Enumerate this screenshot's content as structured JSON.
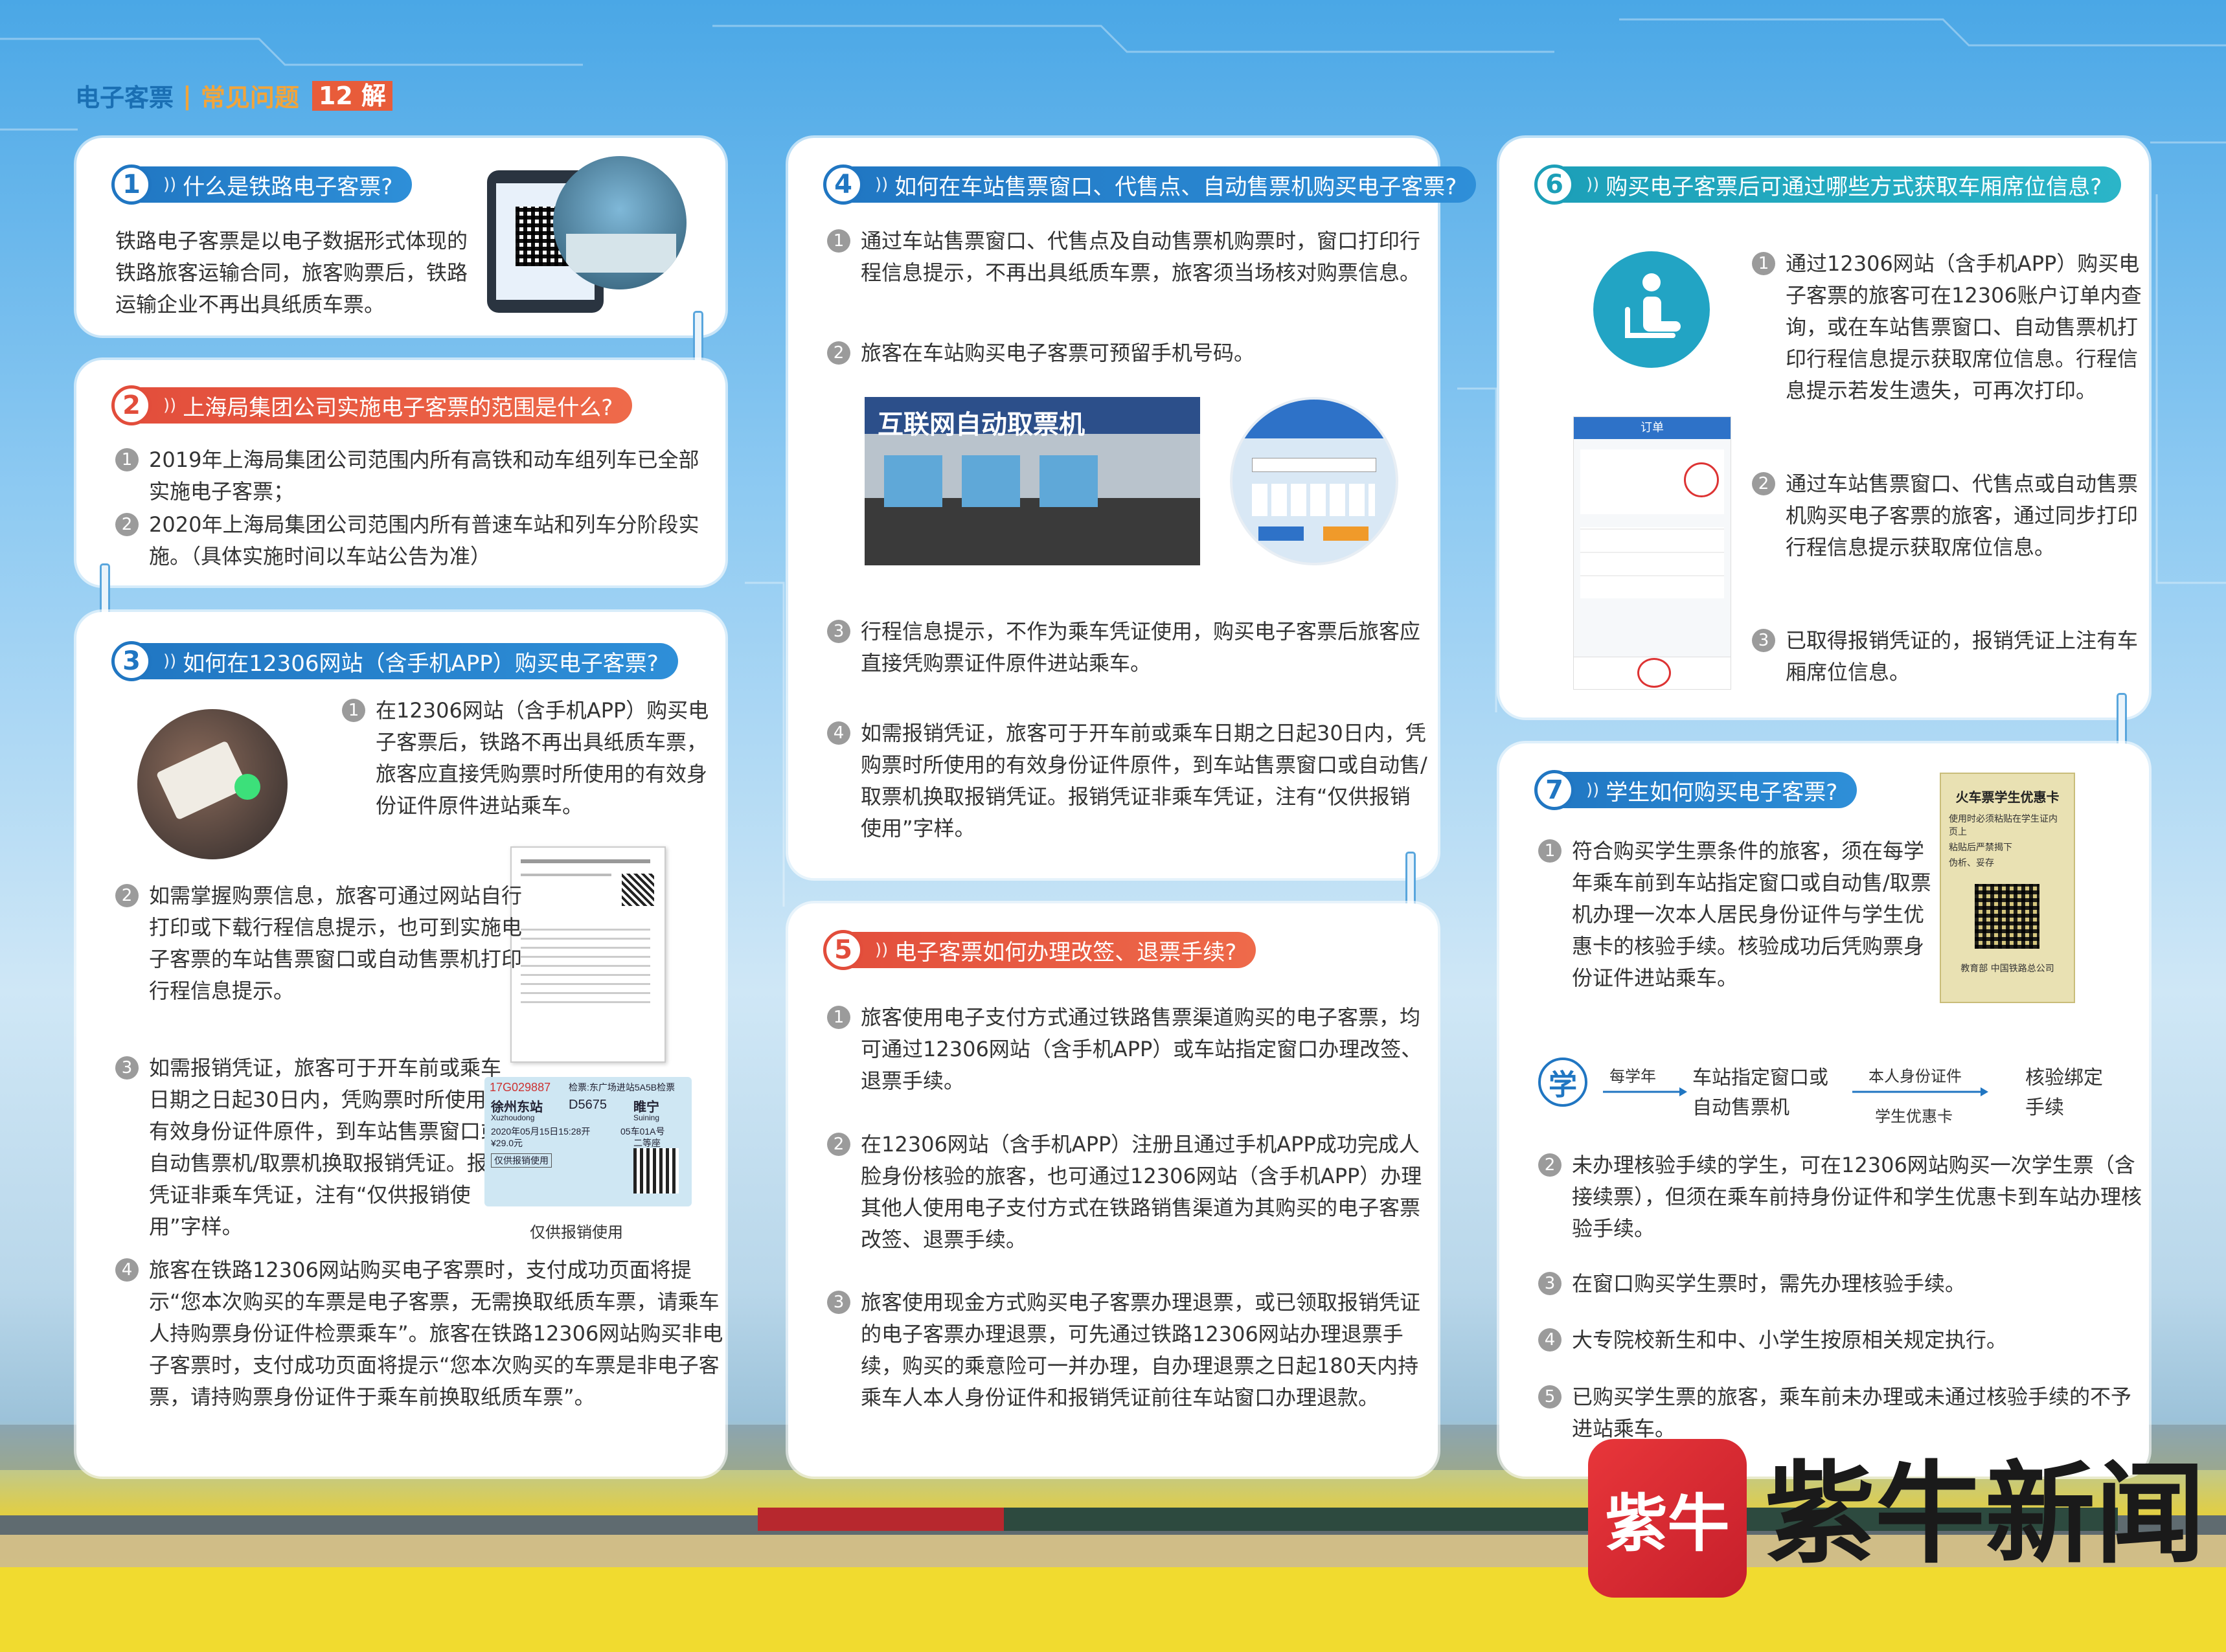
{
  "header": {
    "title": "电子客票",
    "section": "常见问题",
    "count": "12",
    "suffix": "解"
  },
  "q1": {
    "num": "1",
    "question": "什么是铁路电子客票?",
    "answer": "铁路电子客票是以电子数据形式体现的铁路旅客运输合同，旅客购票后，铁路运输企业不再出具纸质车票。"
  },
  "q2": {
    "num": "2",
    "question": "上海局集团公司实施电子客票的范围是什么?",
    "items": [
      {
        "n": "1",
        "text": "2019年上海局集团公司范围内所有高铁和动车组列车已全部实施电子客票；"
      },
      {
        "n": "2",
        "text": "2020年上海局集团公司范围内所有普速车站和列车分阶段实施。（具体实施时间以车站公告为准）"
      }
    ]
  },
  "q3": {
    "num": "3",
    "question": "如何在12306网站（含手机APP）购买电子客票?",
    "items": [
      {
        "n": "1",
        "text": "在12306网站（含手机APP）购买电子客票后，铁路不再出具纸质车票，旅客应直接凭购票时所使用的有效身份证件原件进站乘车。"
      },
      {
        "n": "2",
        "text": "如需掌握购票信息，旅客可通过网站自行打印或下载行程信息提示，也可到实施电子客票的车站售票窗口或自动售票机打印行程信息提示。"
      },
      {
        "n": "3",
        "text": "如需报销凭证，旅客可于开车前或乘车日期之日起30日内，凭购票时所使用的有效身份证件原件，到车站售票窗口或自动售票机/取票机换取报销凭证。报销凭证非乘车凭证，注有“仅供报销使用”字样。"
      },
      {
        "n": "4",
        "text": "旅客在铁路12306网站购买电子客票时，支付成功页面将提示“您本次购买的车票是电子客票，无需换取纸质车票，请乘车人持购票身份证件检票乘车”。旅客在铁路12306网站购买非电子客票时，支付成功页面将提示“您本次购买的车票是非电子客票，请持购票身份证件于乘车前换取纸质车票”。"
      }
    ],
    "ticket": {
      "code": "17G029887",
      "gate": "检票:东广场进站5A5B检票",
      "from": "徐州东站",
      "train": "D5675",
      "to": "睢宁",
      "from_py": "Xuzhoudong",
      "to_py": "Suining",
      "date": "2020年05月15日15:28开",
      "seat": "05车01A号",
      "price": "¥29.0元",
      "class": "二等座",
      "label": "仅供报销使用",
      "caption": "仅供报销使用"
    }
  },
  "q4": {
    "num": "4",
    "question": "如何在车站售票窗口、代售点、自动售票机购买电子客票?",
    "items": [
      {
        "n": "1",
        "text": "通过车站售票窗口、代售点及自动售票机购票时，窗口打印行程信息提示，不再出具纸质车票，旅客须当场核对购票信息。"
      },
      {
        "n": "2",
        "text": "旅客在车站购买电子客票可预留手机号码。"
      },
      {
        "n": "3",
        "text": "行程信息提示，不作为乘车凭证使用，购买电子客票后旅客应直接凭购票证件原件进站乘车。"
      },
      {
        "n": "4",
        "text": "如需报销凭证，旅客可于开车前或乘车日期之日起30日内，凭购票时所使用的有效身份证件原件，到车站售票窗口或自动售/取票机换取报销凭证。报销凭证非乘车凭证，注有“仅供报销使用”字样。"
      }
    ],
    "photo_sign": "互联网自动取票机"
  },
  "q5": {
    "num": "5",
    "question": "电子客票如何办理改签、退票手续?",
    "items": [
      {
        "n": "1",
        "text": "旅客使用电子支付方式通过铁路售票渠道购买的电子客票，均可通过12306网站（含手机APP）或车站指定窗口办理改签、退票手续。"
      },
      {
        "n": "2",
        "text": "在12306网站（含手机APP）注册且通过手机APP成功完成人脸身份核验的旅客，也可通过12306网站（含手机APP）办理其他人使用电子支付方式在铁路销售渠道为其购买的电子客票改签、退票手续。"
      },
      {
        "n": "3",
        "text": "旅客使用现金方式购买电子客票办理退票，或已领取报销凭证的电子客票办理退票，可先通过铁路12306网站办理退票手续，购买的乘意险可一并办理，自办理退票之日起180天内持乘车人本人身份证件和报销凭证前往车站窗口办理退款。"
      }
    ]
  },
  "q6": {
    "num": "6",
    "question": "购买电子客票后可通过哪些方式获取车厢席位信息?",
    "items": [
      {
        "n": "1",
        "text": "通过12306网站（含手机APP）购买电子客票的旅客可在12306账户订单内查询，或在车站售票窗口、自动售票机打印行程信息提示获取席位信息。行程信息提示若发生遗失，可再次打印。"
      },
      {
        "n": "2",
        "text": "通过车站售票窗口、代售点或自动售票机购买电子客票的旅客，通过同步打印行程信息提示获取席位信息。"
      },
      {
        "n": "3",
        "text": "已取得报销凭证的，报销凭证上注有车厢席位信息。"
      }
    ],
    "app_title": "订单"
  },
  "q7": {
    "num": "7",
    "question": "学生如何购买电子客票?",
    "items": [
      {
        "n": "1",
        "text": "符合购买学生票条件的旅客，须在每学年乘车前到车站指定窗口或自动售/取票机办理一次本人居民身份证件与学生优惠卡的核验手续。核验成功后凭购票身份证件进站乘车。"
      },
      {
        "n": "2",
        "text": "未办理核验手续的学生，可在12306网站购买一次学生票（含接续票），但须在乘车前持身份证件和学生优惠卡到车站办理核验手续。"
      },
      {
        "n": "3",
        "text": "在窗口购买学生票时，需先办理核验手续。"
      },
      {
        "n": "4",
        "text": "大专院校新生和中、小学生按原相关规定执行。"
      },
      {
        "n": "5",
        "text": "已购买学生票的旅客，乘车前未办理或未通过核验手续的不予进站乘车。"
      }
    ],
    "flow": {
      "icon": "学",
      "step1": "每学年",
      "step2": "车站指定窗口或自动售票机",
      "step3a": "本人身份证件",
      "step3b": "学生优惠卡",
      "step4": "核验绑定手续"
    },
    "card": {
      "title": "火车票学生优惠卡",
      "lines": [
        "使用时必须粘贴在学生证内页上",
        "粘贴后严禁揭下",
        "伪析、妥存"
      ],
      "footer": "教育部 中国铁路总公司"
    }
  },
  "logo": {
    "text": "紫牛新闻",
    "mark": "紫牛"
  },
  "colors": {
    "blue": "#2076c2",
    "red": "#e24d3b",
    "teal": "#1c9fb8"
  }
}
